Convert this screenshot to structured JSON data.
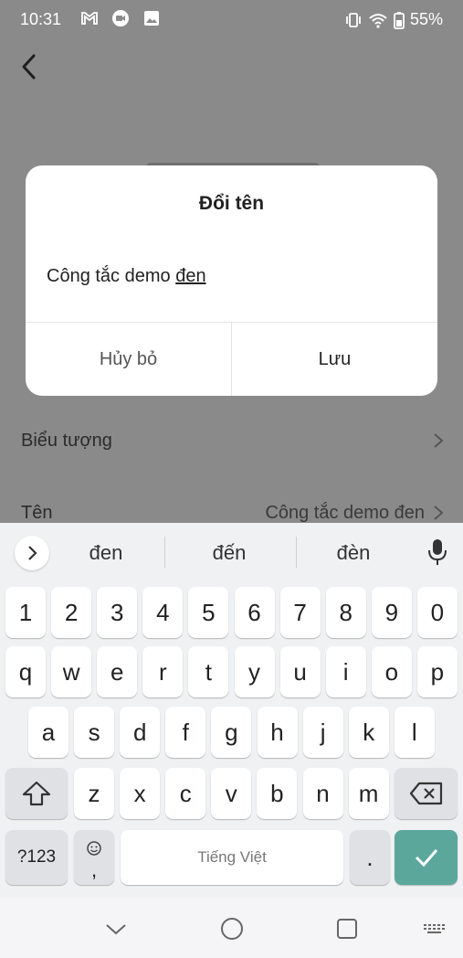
{
  "status_bar": {
    "time": "10:31",
    "battery": "55%"
  },
  "settings": {
    "rows": [
      {
        "label": "Biểu tượng",
        "value": ""
      },
      {
        "label": "Tên",
        "value": "Công tắc demo đen"
      }
    ]
  },
  "dialog": {
    "title": "Đổi tên",
    "field_prefix": "Công tắc demo ",
    "field_underlined": "đen",
    "cancel_label": "Hủy bỏ",
    "save_label": "Lưu"
  },
  "keyboard": {
    "suggestions": [
      "đen",
      "đến",
      "đèn"
    ],
    "row_numbers": [
      "1",
      "2",
      "3",
      "4",
      "5",
      "6",
      "7",
      "8",
      "9",
      "0"
    ],
    "row_top": [
      "q",
      "w",
      "e",
      "r",
      "t",
      "y",
      "u",
      "i",
      "o",
      "p"
    ],
    "row_home": [
      "a",
      "s",
      "d",
      "f",
      "g",
      "h",
      "j",
      "k",
      "l"
    ],
    "row_bottom": [
      "z",
      "x",
      "c",
      "v",
      "b",
      "n",
      "m"
    ],
    "symbols_label": "?123",
    "emoji_comma": ",",
    "space_label": "Tiếng Việt",
    "period": "."
  },
  "colors": {
    "enter": "#5ba79b",
    "overlay": "#8a8a8a"
  }
}
